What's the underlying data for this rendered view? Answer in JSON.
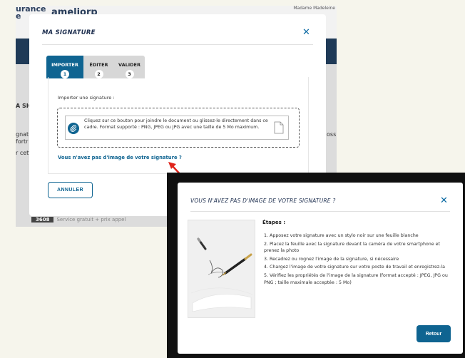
{
  "site": {
    "logo_left": "urance\ne",
    "logo": "ameliorp",
    "user_info": "Madame Madeleine",
    "ghost_left_1": "A SIG",
    "ghost_left_2": "gnatu",
    "ghost_left_3": "fortr",
    "ghost_left_4": "r cett",
    "ghost_right": "ossib",
    "footer_phone": "3608",
    "footer_note": "Service gratuit + prix appel"
  },
  "modal_signature": {
    "title": "MA SIGNATURE",
    "close_label": "✕",
    "tabs": [
      {
        "label": "IMPORTER",
        "number": "1",
        "active": true
      },
      {
        "label": "ÉDITER",
        "number": "2",
        "active": false
      },
      {
        "label": "VALIDER",
        "number": "3",
        "active": false
      }
    ],
    "import_label": "Importer une signature :",
    "dropzone_text": "Cliquez sur ce bouton pour joindre le document ou glissez-le directement dans ce cadre. Format supporté : PNG, JPEG ou JPG avec une taille de 5 Mo maximum.",
    "no_image_link": "Vous n'avez pas d'image de votre signature ?",
    "cancel_button": "ANNULER"
  },
  "modal_help": {
    "title": "VOUS N'AVEZ PAS D'IMAGE DE VOTRE SIGNATURE ?",
    "close_label": "✕",
    "steps_title": "Étapes :",
    "steps": [
      "1. Apposez votre signature avec un stylo noir sur une feuille blanche",
      "2. Placez la feuille avec la signature devant la caméra de votre smartphone et prenez la photo",
      "3. Recadrez ou rognez l'image de la signature, si nécessaire",
      "4. Chargez l'image de votre signature sur votre poste de travail et enregistrez-la",
      "5. Vérifiez les propriétés de l'image de la signature (format accepté : JPEG, JPG ou PNG ; taille maximale acceptée : 5 Mo)"
    ],
    "back_button": "Retour"
  },
  "colors": {
    "primary": "#0f6491",
    "title": "#1f3050",
    "arrow": "#e0241b",
    "band": "#1f3a57"
  },
  "icons": {
    "close": "close-icon",
    "attach": "paperclip-icon",
    "document": "document-icon",
    "arrow": "red-arrow-icon",
    "illustration": "pen-signature-illustration"
  }
}
